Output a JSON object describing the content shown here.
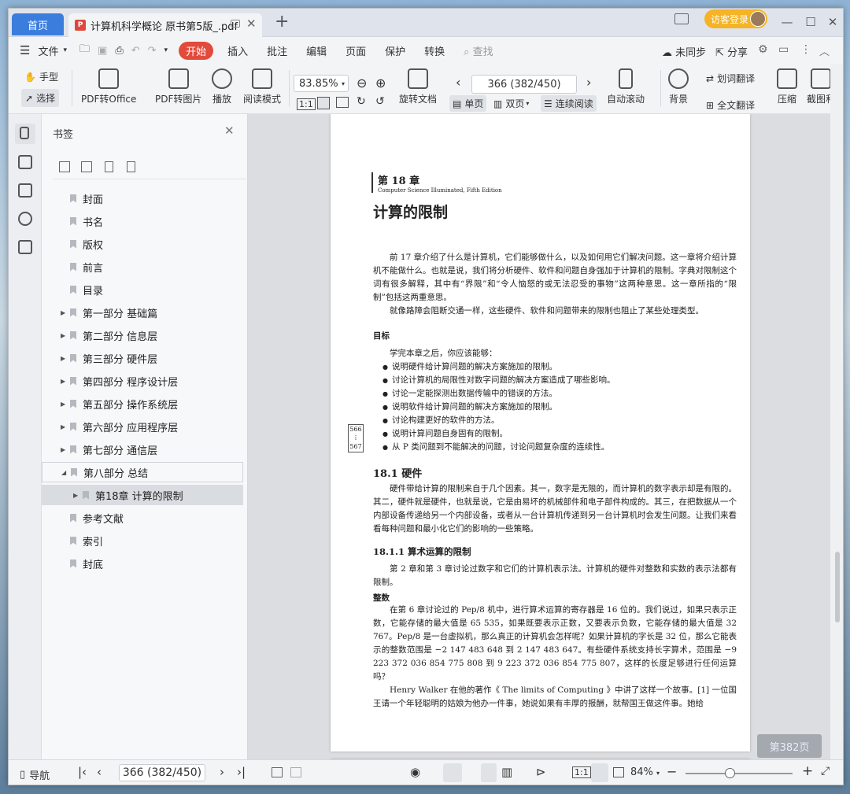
{
  "titlebar": {
    "home_tab": "首页",
    "doc_tab": "计算机科学概论 原书第5版_.pdf",
    "login": "访客登录"
  },
  "menubar": {
    "file": "文件",
    "items": [
      "开始",
      "插入",
      "批注",
      "编辑",
      "页面",
      "保护",
      "转换"
    ],
    "search": "查找",
    "sync": "未同步",
    "share": "分享"
  },
  "ribbon": {
    "hand": "手型",
    "select": "选择",
    "pdf_to_office": "PDF转Office",
    "pdf_to_image": "PDF转图片",
    "play": "播放",
    "read_mode": "阅读模式",
    "zoom": "83.85%",
    "rotate": "旋转文档",
    "page_input": "366 (382/450)",
    "single": "单页",
    "double": "双页",
    "continuous": "连续阅读",
    "autoscroll": "自动滚动",
    "background": "背景",
    "translate_word": "划词翻译",
    "translate_all": "全文翻译",
    "compress": "压缩",
    "screenshot": "截图和"
  },
  "bookmarks": {
    "title": "书签",
    "items": [
      {
        "label": "封面",
        "level": 0,
        "expand": false
      },
      {
        "label": "书名",
        "level": 0,
        "expand": false
      },
      {
        "label": "版权",
        "level": 0,
        "expand": false
      },
      {
        "label": "前言",
        "level": 0,
        "expand": false
      },
      {
        "label": "目录",
        "level": 0,
        "expand": false
      },
      {
        "label": "第一部分  基础篇",
        "level": 0,
        "expand": true
      },
      {
        "label": "第二部分  信息层",
        "level": 0,
        "expand": true
      },
      {
        "label": "第三部分  硬件层",
        "level": 0,
        "expand": true
      },
      {
        "label": "第四部分  程序设计层",
        "level": 0,
        "expand": true
      },
      {
        "label": "第五部分  操作系统层",
        "level": 0,
        "expand": true
      },
      {
        "label": "第六部分  应用程序层",
        "level": 0,
        "expand": true
      },
      {
        "label": "第七部分  通信层",
        "level": 0,
        "expand": true
      },
      {
        "label": "第八部分  总结",
        "level": 0,
        "expand": "open"
      },
      {
        "label": "第18章  计算的限制",
        "level": 1,
        "expand": true
      },
      {
        "label": "参考文献",
        "level": 0,
        "expand": false
      },
      {
        "label": "索引",
        "level": 0,
        "expand": false
      },
      {
        "label": "封底",
        "level": 0,
        "expand": false
      }
    ]
  },
  "page": {
    "chapter": "第 18 章",
    "edition": "Computer Science Illuminated, Fifth Edition",
    "title": "计算的限制",
    "intro1": "前 17 章介绍了什么是计算机，它们能够做什么，以及如何用它们解决问题。这一章将介绍计算机不能做什么。也就是说，我们将分析硬件、软件和问题自身强加于计算机的限制。字典对限制这个词有很多解释，其中有“界限”和“令人恼怒的或无法忍受的事物”这两种意思。这一章所指的“限制”包括这两重意思。",
    "intro2": "就像路障会阻断交通一样，这些硬件、软件和问题带来的限制也阻止了某些处理类型。",
    "goal_head": "目标",
    "goal_lead": "学完本章之后，你应该能够：",
    "goals": [
      "说明硬件给计算问题的解决方案施加的限制。",
      "讨论计算机的局限性对数字问题的解决方案造成了哪些影响。",
      "讨论一定能探测出数据传输中的错误的方法。",
      "说明软件给计算问题的解决方案施加的限制。",
      "讨论构建更好的软件的方法。",
      "说明计算问题自身固有的限制。",
      "从 P 类问题到不能解决的问题，讨论问题复杂度的连续性。"
    ],
    "margin_top": "566",
    "margin_mid": "⁞",
    "margin_bot": "567",
    "s1_head": "18.1   硬件",
    "s1_body": "硬件带给计算的限制来自于几个因素。其一，数字是无限的，而计算机的数字表示却是有限的。其二，硬件就是硬件，也就是说，它是由易坏的机械部件和电子部件构成的。其三，在把数据从一个内部设备传递给另一个内部设备，或者从一台计算机传递到另一台计算机时会发生问题。让我们来看看每种问题和最小化它们的影响的一些策略。",
    "s2_head": "18.1.1   算术运算的限制",
    "s2_body": "第 2 章和第 3 章讨论过数字和它们的计算机表示法。计算机的硬件对整数和实数的表示法都有限制。",
    "s3_head": "整数",
    "s3_body": "在第 6 章讨论过的 Pep/8 机中，进行算术运算的寄存器是 16 位的。我们说过，如果只表示正数，它能存储的最大值是 65 535，如果既要表示正数，又要表示负数，它能存储的最大值是 32 767。Pep/8 是一台虚拟机，那么真正的计算机会怎样呢？如果计算机的字长是 32 位，那么它能表示的整数范围是 −2 147 483 648 到 2 147 483 647。有些硬件系统支持长字算术，范围是 −9 223 372 036 854 775 808 到 9 223 372 036 854 775 807，这样的长度足够进行任何运算吗？",
    "s4_body": "Henry Walker 在他的著作《 The limits of Computing 》中讲了这样一个故事。[1] 一位国王请一个年轻聪明的姑娘为他办一件事，她说如果有丰厚的报酬，就帮国王做这件事。她给"
  },
  "statusbar": {
    "nav": "导航",
    "page_input": "366 (382/450)",
    "zoom": "84%",
    "badge": "第382页"
  }
}
